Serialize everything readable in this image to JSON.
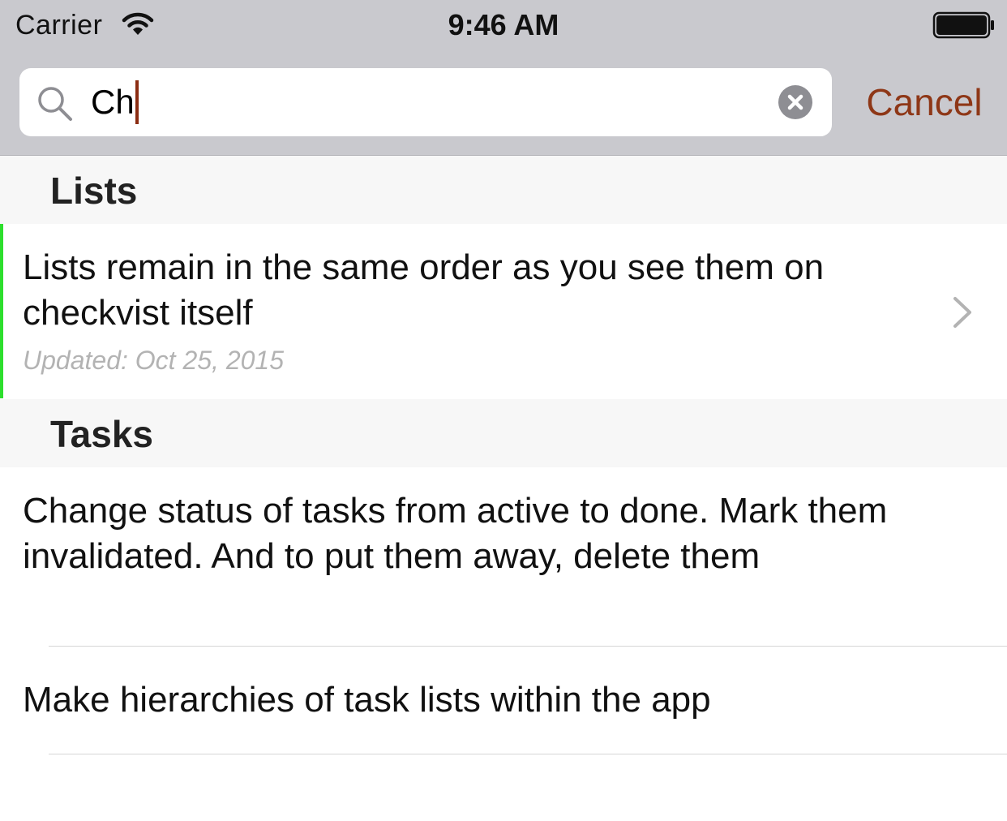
{
  "status_bar": {
    "carrier": "Carrier",
    "time": "9:46 AM",
    "icons": [
      "wifi-icon",
      "battery-icon"
    ]
  },
  "search": {
    "value": "Ch",
    "clear_icon": "clear-icon",
    "search_icon": "search-icon",
    "cancel_label": "Cancel"
  },
  "colors": {
    "accent": "#8e3717",
    "list_indicator": "#2ddf2d",
    "top_bar": "#c9c9ce"
  },
  "sections": {
    "lists": {
      "title": "Lists",
      "items": [
        {
          "text": "Lists remain in the same order as you see them on checkvist itself",
          "meta": "Updated: Oct 25, 2015"
        }
      ]
    },
    "tasks": {
      "title": "Tasks",
      "items": [
        {
          "text": "Change status of tasks from active to done. Mark them invalidated. And to put them away, delete them"
        },
        {
          "text": "Make hierarchies of task lists within the app"
        }
      ]
    }
  }
}
